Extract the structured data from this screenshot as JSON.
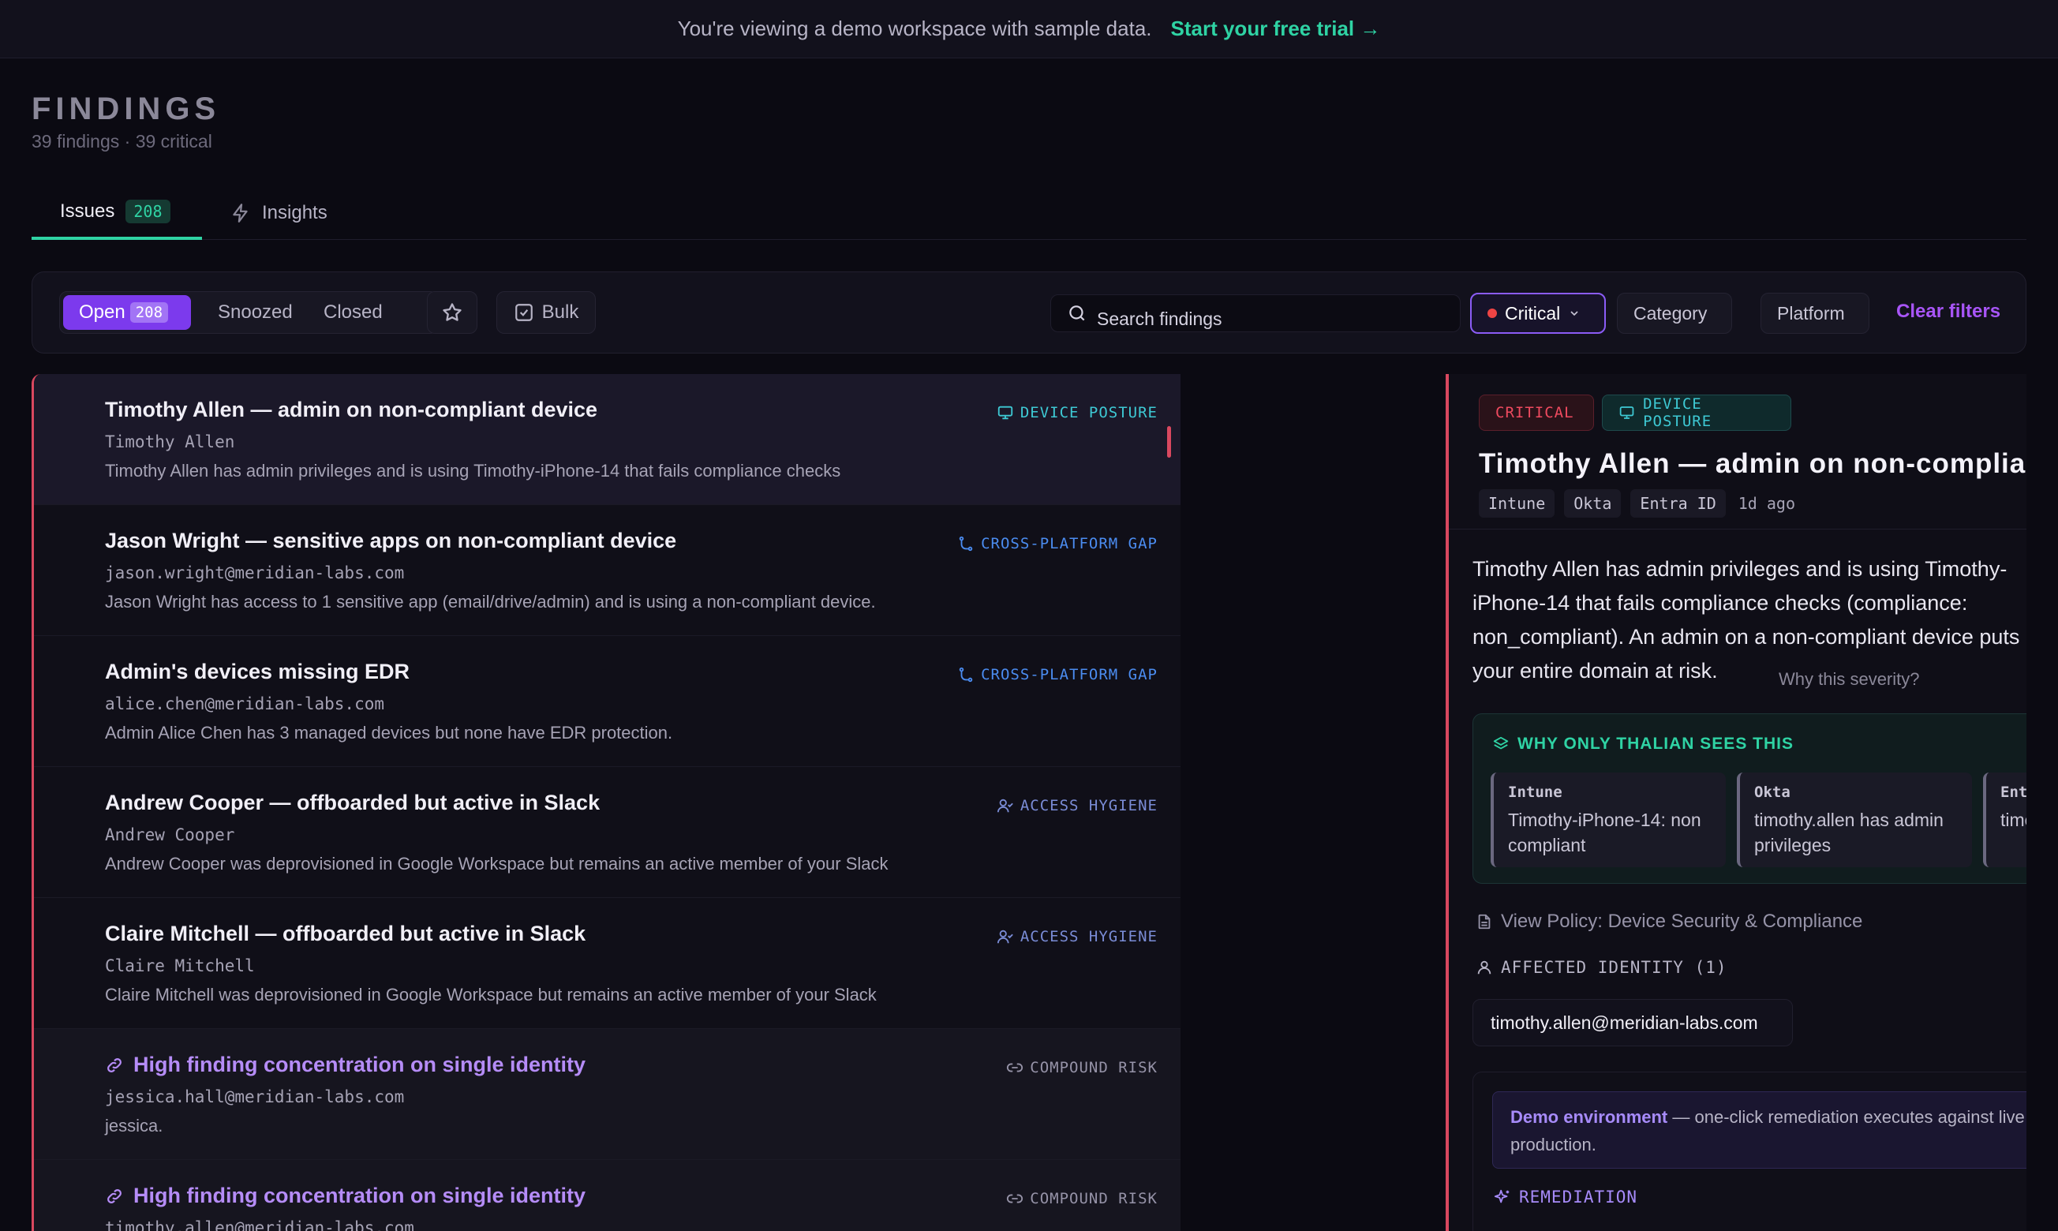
{
  "banner": {
    "text": "You're viewing a demo workspace with sample data.",
    "cta": "Start your free trial →"
  },
  "header": {
    "title": "FINDINGS",
    "subtitle": "39 findings · 39 critical"
  },
  "tabs": [
    {
      "label": "Issues",
      "badge": "208",
      "active": true
    },
    {
      "label": "Insights",
      "icon": "lightning-icon"
    }
  ],
  "filters": {
    "status": [
      {
        "label": "Open",
        "count": "208",
        "active": true
      },
      {
        "label": "Snoozed"
      },
      {
        "label": "Closed"
      }
    ],
    "bulk_label": "Bulk",
    "search_placeholder": "Search findings",
    "severity": "Critical",
    "category": "Category",
    "platform": "Platform",
    "clear": "Clear filters"
  },
  "findings": [
    {
      "title": "Timothy Allen — admin on non-compliant device",
      "subject": "Timothy Allen",
      "description": "Timothy Allen has admin privileges and is using Timothy-iPhone-14 that fails compliance checks",
      "category": "DEVICE POSTURE",
      "icon": "monitor-icon"
    },
    {
      "title": "Jason Wright — sensitive apps on non-compliant device",
      "subject": "jason.wright@meridian-labs.com",
      "description": "Jason Wright has access to 1 sensitive app (email/drive/admin) and is using a non-compliant device.",
      "category": "CROSS-PLATFORM GAP",
      "icon": "branch-icon"
    },
    {
      "title": "Admin's devices missing EDR",
      "subject": "alice.chen@meridian-labs.com",
      "description": "Admin Alice Chen has 3 managed devices but none have EDR protection.",
      "category": "CROSS-PLATFORM GAP",
      "icon": "branch-icon"
    },
    {
      "title": "Andrew Cooper — offboarded but active in Slack",
      "subject": "Andrew Cooper",
      "description": "Andrew Cooper was deprovisioned in Google Workspace but remains an active member of your Slack",
      "category": "ACCESS HYGIENE",
      "icon": "user-check-icon"
    },
    {
      "title": "Claire Mitchell — offboarded but active in Slack",
      "subject": "Claire Mitchell",
      "description": "Claire Mitchell was deprovisioned in Google Workspace but remains an active member of your Slack",
      "category": "ACCESS HYGIENE",
      "icon": "user-check-icon"
    },
    {
      "title": "High finding concentration on single identity",
      "subject": "jessica.hall@meridian-labs.com",
      "description": "jessica.",
      "category": "COMPOUND RISK",
      "icon": "link-icon"
    },
    {
      "title": "High finding concentration on single identity",
      "subject": "timothy.allen@meridian-labs.com",
      "description": "",
      "category": "COMPOUND RISK",
      "icon": "link-icon"
    }
  ],
  "detail": {
    "severity": "CRITICAL",
    "category": "DEVICE POSTURE",
    "title": "Timothy Allen — admin on non-compliant device",
    "platforms": [
      "Intune",
      "Okta",
      "Entra ID"
    ],
    "age": "1d ago",
    "description": "Timothy Allen has admin privileges and is using Timothy-iPhone-14 that fails compliance checks (compliance: non_compliant). An admin on a non-compliant device puts your entire domain at risk.",
    "why_severity": "Why this severity?",
    "why_only": "WHY ONLY THALIAN SEES THIS",
    "sources": [
      {
        "name": "Intune",
        "text": "Timothy-iPhone-14: non compliant"
      },
      {
        "name": "Okta",
        "text": "timothy.allen has admin privileges"
      },
      {
        "name": "Entra ID",
        "text": "timothy.allen privileged"
      }
    ],
    "policy_link": "View Policy: Device Security & Compliance",
    "affected_heading": "AFFECTED IDENTITY (1)",
    "affected_identity": "timothy.allen@meridian-labs.com",
    "demo_label": "Demo environment",
    "demo_text": " — one-click remediation executes against live production.",
    "remediation_heading": "REMEDIATION"
  },
  "colors": {
    "accent_purple": "#7c3aed",
    "accent_teal": "#2fd3a4",
    "critical_red": "#d9485f"
  }
}
